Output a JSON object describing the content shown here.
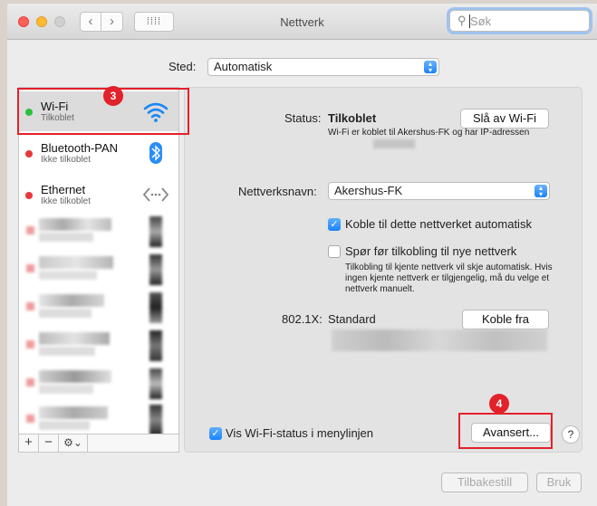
{
  "window": {
    "title": "Nettverk"
  },
  "search": {
    "placeholder": "Søk"
  },
  "location": {
    "label": "Sted:",
    "value": "Automatisk"
  },
  "networks": [
    {
      "name": "Wi-Fi",
      "status": "Tilkoblet",
      "icon": "wifi-icon",
      "status_color": "#2cc13a",
      "selected": true
    },
    {
      "name": "Bluetooth-PAN",
      "status": "Ikke tilkoblet",
      "icon": "bluetooth-icon",
      "status_color": "#e8383a"
    },
    {
      "name": "Ethernet",
      "status": "Ikke tilkoblet",
      "icon": "ethernet-icon",
      "status_color": "#e8383a"
    }
  ],
  "sidebar_tools": {
    "add": "+",
    "remove": "−",
    "gear": "⚙⌄"
  },
  "detail": {
    "status_label": "Status:",
    "status_value": "Tilkoblet",
    "turn_off_button": "Slå av Wi-Fi",
    "status_description": "Wi-Fi er koblet til Akershus-FK og har IP-adressen",
    "network_name_label": "Nettverksnavn:",
    "network_name_value": "Akershus-FK",
    "auto_join_label": "Koble til dette nettverket automatisk",
    "auto_join_checked": true,
    "ask_join_label": "Spør før tilkobling til nye nettverk",
    "ask_join_checked": false,
    "ask_join_help": "Tilkobling til kjente nettverk vil skje automatisk. Hvis ingen kjente nettverk er tilgjengelig, må du velge et nettverk manuelt.",
    "dot1x_label": "802.1X:",
    "dot1x_value": "Standard",
    "disconnect_button": "Koble fra",
    "show_status_label": "Vis Wi-Fi-status i menylinjen",
    "show_status_checked": true,
    "advanced_button": "Avansert...",
    "help_button": "?"
  },
  "footer": {
    "revert_button": "Tilbakestill",
    "apply_button": "Bruk"
  },
  "annotations": [
    {
      "number": "3"
    },
    {
      "number": "4"
    }
  ],
  "colors": {
    "accent": "#1c84fb",
    "annotation_red": "#e3212a"
  }
}
